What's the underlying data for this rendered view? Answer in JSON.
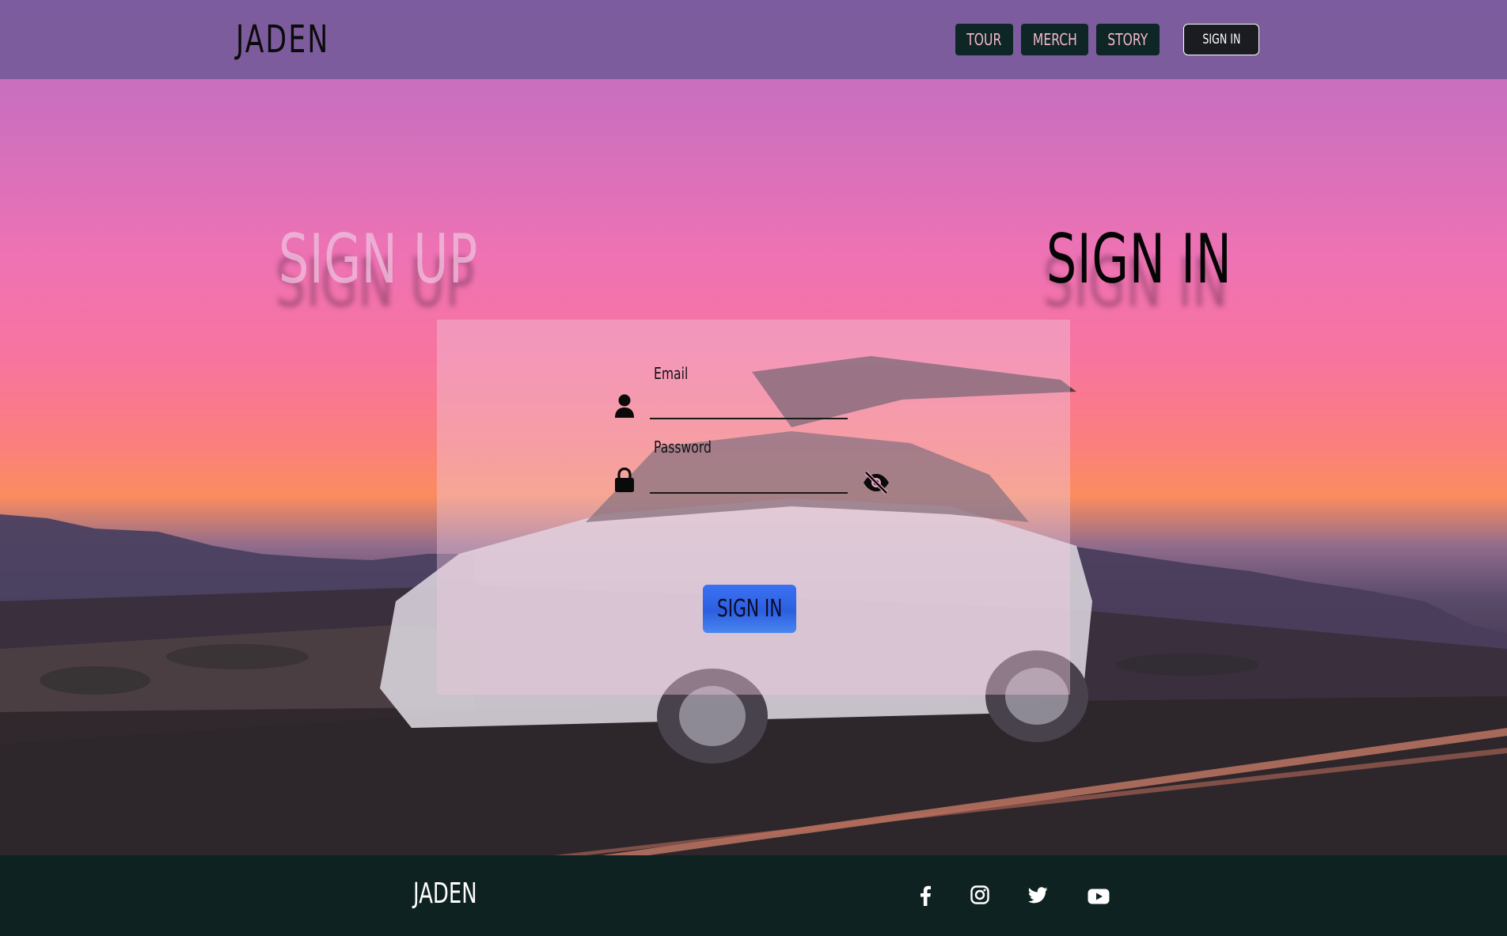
{
  "header": {
    "brand": "JADEN",
    "nav": [
      {
        "label": "TOUR"
      },
      {
        "label": "MERCH"
      },
      {
        "label": "STORY"
      }
    ],
    "signin_label": "SIGN IN"
  },
  "auth": {
    "signup_title": "SIGN UP",
    "signin_title": "SIGN IN"
  },
  "form": {
    "email_label": "Email",
    "email_value": "",
    "password_label": "Password",
    "password_value": "",
    "submit_label": "SIGN IN",
    "icons": {
      "user": "user-icon",
      "lock": "lock-icon",
      "toggle_visibility": "eye-slash-icon"
    }
  },
  "footer": {
    "brand": "JADEN",
    "social": [
      "facebook-icon",
      "instagram-icon",
      "twitter-icon",
      "youtube-icon"
    ]
  },
  "colors": {
    "header_bg": "#7a5c9c",
    "nav_button_bg": "#0e2626",
    "nav_button_text": "#f3b6c8",
    "submit_button": "#2c5fe0",
    "footer_bg": "#0f2222"
  }
}
